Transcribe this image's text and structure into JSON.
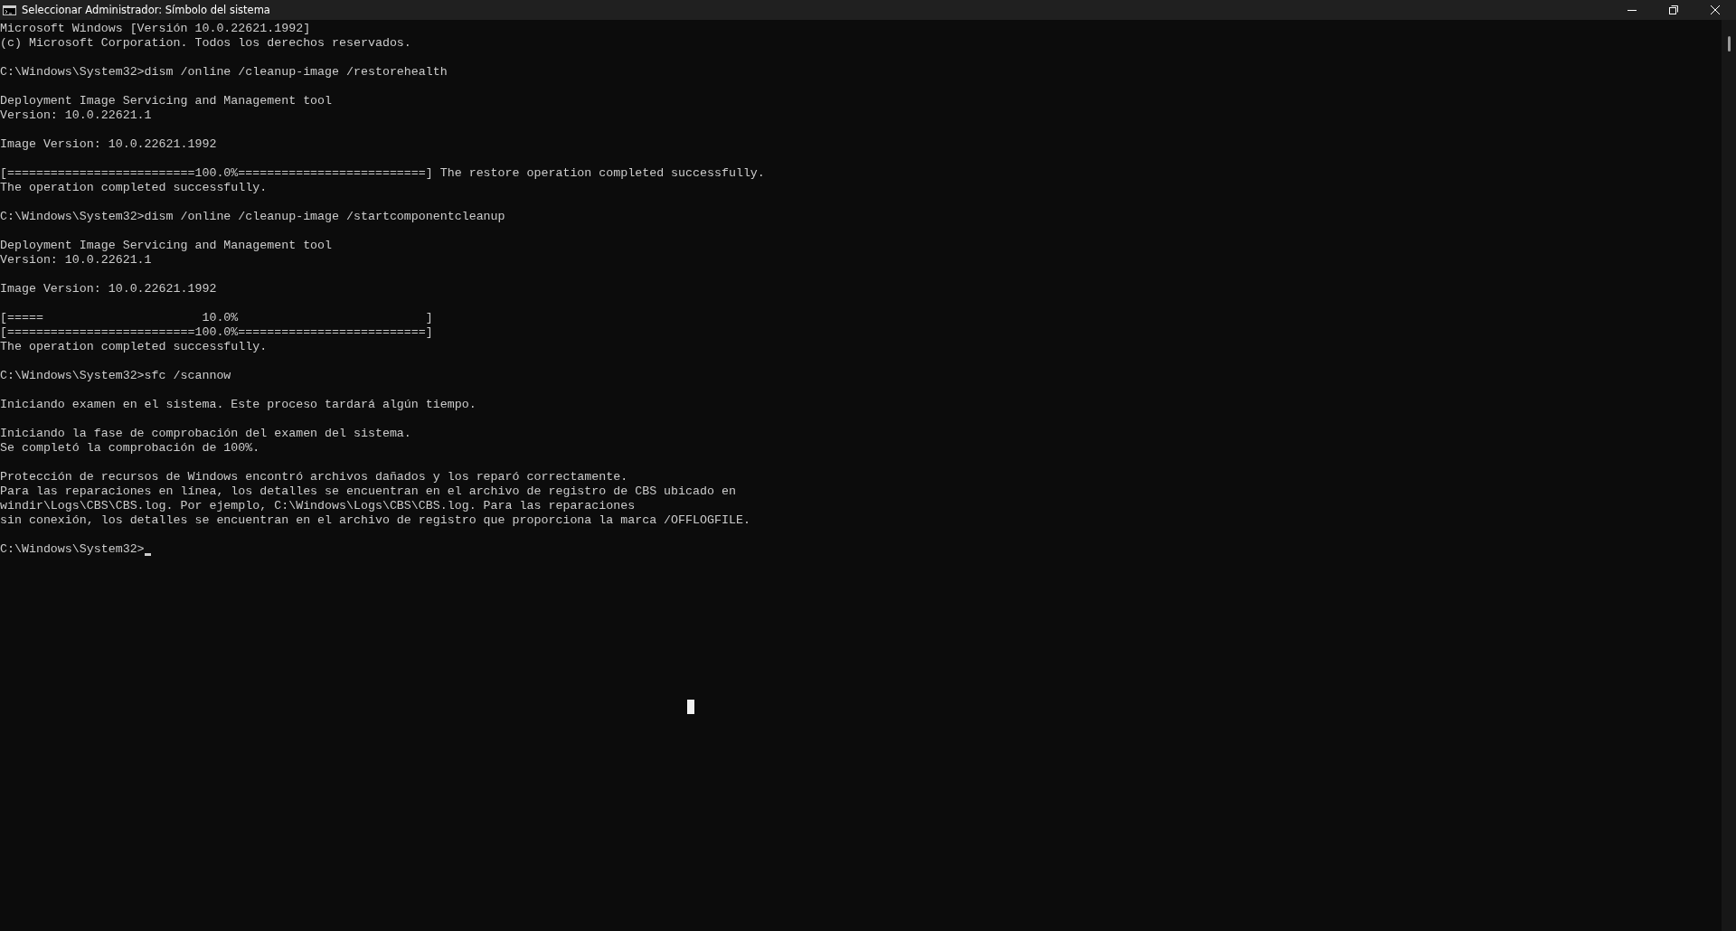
{
  "window": {
    "title": "Seleccionar Administrador: Símbolo del sistema"
  },
  "console": {
    "blocks": [
      [
        "Microsoft Windows [Versión 10.0.22621.1992]",
        "(c) Microsoft Corporation. Todos los derechos reservados."
      ],
      [
        "C:\\Windows\\System32>dism /online /cleanup-image /restorehealth"
      ],
      [
        "Deployment Image Servicing and Management tool",
        "Version: 10.0.22621.1"
      ],
      [
        "Image Version: 10.0.22621.1992"
      ],
      [
        "[==========================100.0%==========================] The restore operation completed successfully.",
        "The operation completed successfully."
      ],
      [
        "C:\\Windows\\System32>dism /online /cleanup-image /startcomponentcleanup"
      ],
      [
        "Deployment Image Servicing and Management tool",
        "Version: 10.0.22621.1"
      ],
      [
        "Image Version: 10.0.22621.1992"
      ],
      [
        "[=====                      10.0%                          ]",
        "[==========================100.0%==========================]",
        "The operation completed successfully."
      ],
      [
        "C:\\Windows\\System32>sfc /scannow"
      ],
      [
        "Iniciando examen en el sistema. Este proceso tardará algún tiempo."
      ],
      [
        "Iniciando la fase de comprobación del examen del sistema.",
        "Se completó la comprobación de 100%."
      ],
      [
        "Protección de recursos de Windows encontró archivos dañados y los reparó correctamente.",
        "Para las reparaciones en línea, los detalles se encuentran en el archivo de registro de CBS ubicado en",
        "windir\\Logs\\CBS\\CBS.log. Por ejemplo, C:\\Windows\\Logs\\CBS\\CBS.log. Para las reparaciones",
        "sin conexión, los detalles se encuentran en el archivo de registro que proporciona la marca /OFFLOGFILE."
      ]
    ],
    "prompt": "C:\\Windows\\System32>",
    "cursor_visible": true
  }
}
